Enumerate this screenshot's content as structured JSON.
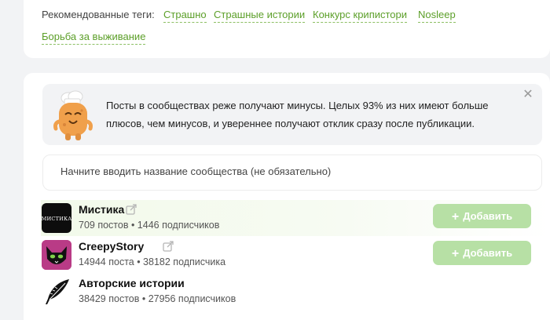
{
  "tags": {
    "label": "Рекомендованные теги:",
    "items": [
      "Страшно",
      "Страшные истории",
      "Конкурс крипистори",
      "Nosleep",
      "Борьба за выживание"
    ]
  },
  "notice": {
    "line1": "Посты в сообществах реже получают минусы. Целых 93% из них имеют больше",
    "line2": "плюсов, чем минусов, и увереннее получают отклик сразу после публикации.",
    "close_icon": "close-icon",
    "mascot_icon": "cookie-mascot-icon"
  },
  "search": {
    "placeholder": "Начните вводить название сообщества (не обязательно)"
  },
  "communities": [
    {
      "name": "Мистика",
      "stats": "709 постов • 1446 подписчиков",
      "avatar_text": "МИСТИКА",
      "add_label": "Добавить",
      "has_link": true
    },
    {
      "name": "CreepyStory",
      "stats": "14944 поста • 38182 подписчика",
      "add_label": "Добавить",
      "has_link": true
    },
    {
      "name": "Авторские истории",
      "stats": "38429 постов • 27956 подписчиков"
    }
  ],
  "colors": {
    "accent": "#5c9f29",
    "button": "#b7e0a5",
    "background": "#f2f3f5"
  }
}
